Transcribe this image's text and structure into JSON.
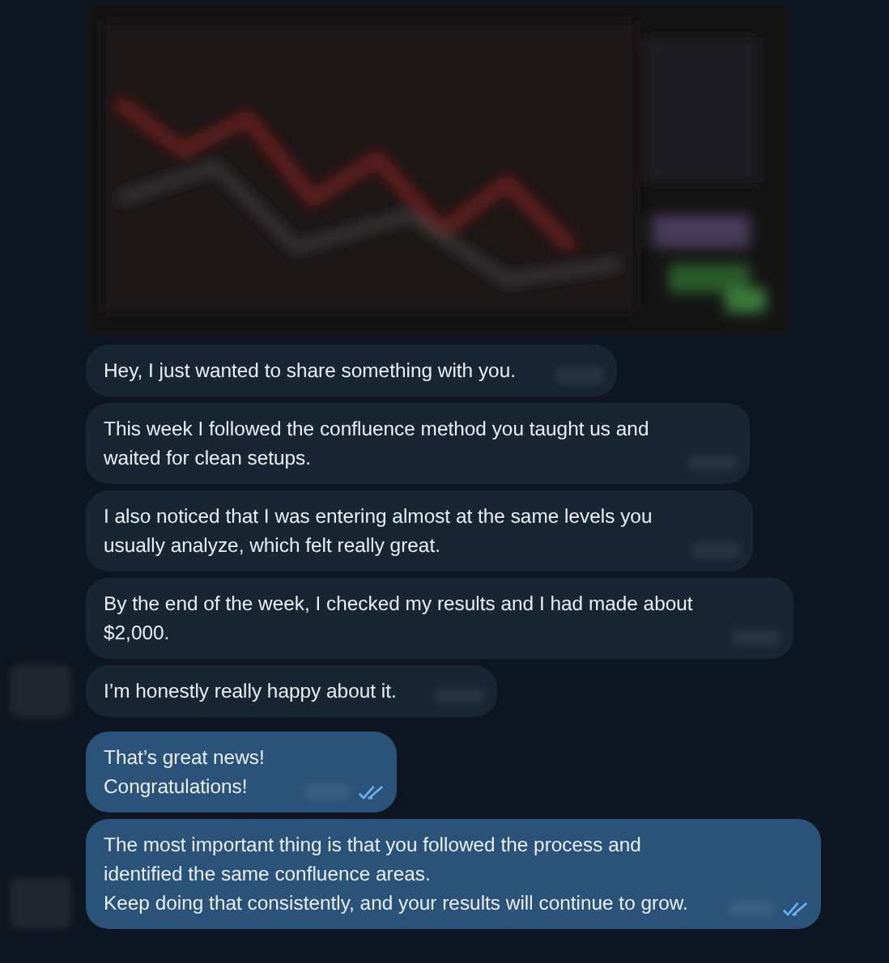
{
  "messages": [
    {
      "kind": "incoming",
      "lines": [
        "Hey, I just wanted to share something with you."
      ]
    },
    {
      "kind": "incoming",
      "lines": [
        "This week I followed the confluence method you taught us and",
        "waited for clean setups."
      ]
    },
    {
      "kind": "incoming",
      "lines": [
        "I also noticed that I was entering almost at the same levels you",
        "usually analyze, which felt really great."
      ]
    },
    {
      "kind": "incoming",
      "lines": [
        "By the end of the week, I checked my results and I had made about",
        "$2,000."
      ]
    },
    {
      "kind": "incoming",
      "lines": [
        "I’m honestly really happy about it."
      ]
    },
    {
      "kind": "outgoing",
      "read": true,
      "lines": [
        "That’s great news!",
        "Congratulations!"
      ]
    },
    {
      "kind": "outgoing",
      "read": true,
      "lines": [
        "The most important thing is that you followed the process and",
        "identified the same confluence areas.",
        "Keep doing that consistently, and your results will continue to grow."
      ]
    }
  ]
}
